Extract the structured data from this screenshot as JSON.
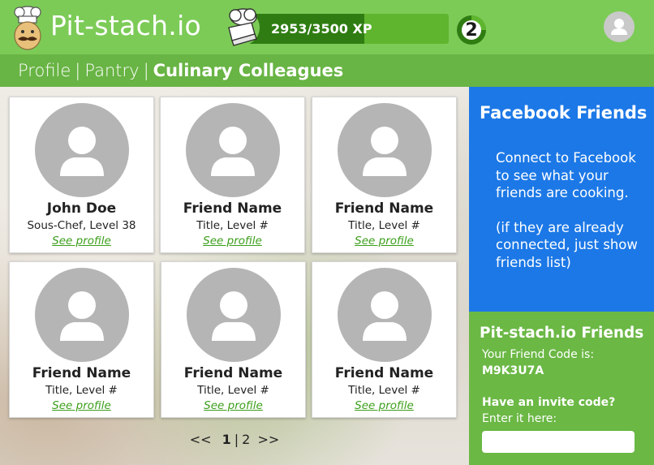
{
  "header": {
    "logo_text": "Pit-stach.io",
    "xp_text": "2953/3500 XP",
    "xp_current": 2953,
    "xp_max": 3500,
    "level": "2"
  },
  "nav": {
    "items": [
      "Profile",
      "Pantry",
      "Culinary Colleagues"
    ],
    "separator": "|",
    "active_index": 2
  },
  "friends": [
    {
      "name": "John Doe",
      "title": "Sous-Chef, Level 38",
      "link": "See profile"
    },
    {
      "name": "Friend Name",
      "title": "Title, Level #",
      "link": "See profile"
    },
    {
      "name": "Friend Name",
      "title": "Title, Level #",
      "link": "See profile"
    },
    {
      "name": "Friend Name",
      "title": "Title, Level #",
      "link": "See profile"
    },
    {
      "name": "Friend Name",
      "title": "Title, Level #",
      "link": "See profile"
    },
    {
      "name": "Friend Name",
      "title": "Title, Level #",
      "link": "See profile"
    }
  ],
  "pagination": {
    "prev": "<<",
    "current": "1",
    "separator": "|",
    "next_page": "2",
    "next": ">>"
  },
  "facebook": {
    "title": "Facebook Friends",
    "body1": "Connect to Facebook to see what your friends are cooking.",
    "body2": "(if they are already connected, just show friends list)"
  },
  "pitstach_friends": {
    "title": "Pit-stach.io Friends",
    "code_label": "Your Friend Code is:",
    "code": "M9K3U7A",
    "invite_label": "Have an invite code?",
    "enter_label": "Enter it here:",
    "input_value": ""
  },
  "colors": {
    "header_green": "#7ccb57",
    "nav_green": "#68b444",
    "xp_fill": "#2f7d12",
    "facebook_blue": "#1c78e6",
    "link_green": "#3b9e1a"
  }
}
